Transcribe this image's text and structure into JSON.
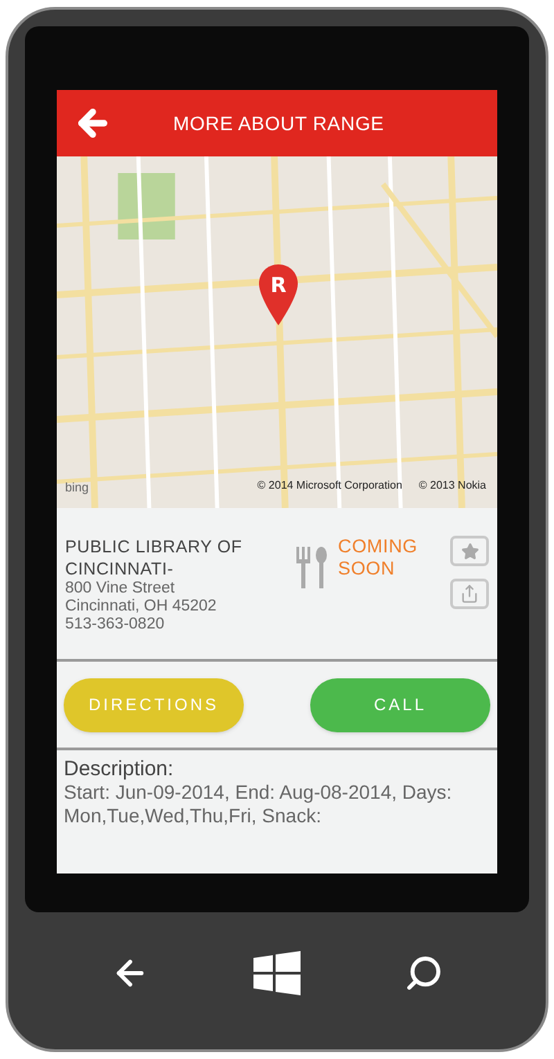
{
  "header": {
    "title": "MORE ABOUT RANGE"
  },
  "map": {
    "pin_label": "R",
    "provider": "bing",
    "attribution": [
      "© 2014 Microsoft Corporation",
      "© 2013 Nokia"
    ]
  },
  "place": {
    "name": "PUBLIC LIBRARY OF CINCINNATI-",
    "address_lines": [
      "800 Vine Street",
      "Cincinnati, OH 45202",
      "513-363-0820"
    ],
    "status": "COMING SOON"
  },
  "actions": [
    {
      "label": "DIRECTIONS",
      "color": "#dfc62a"
    },
    {
      "label": "CALL",
      "color": "#4cb94c"
    }
  ],
  "description": {
    "heading": "Description:",
    "text": "Start: Jun-09-2014, End: Aug-08-2014, Days: Mon,Tue,Wed,Thu,Fri, Snack:"
  }
}
